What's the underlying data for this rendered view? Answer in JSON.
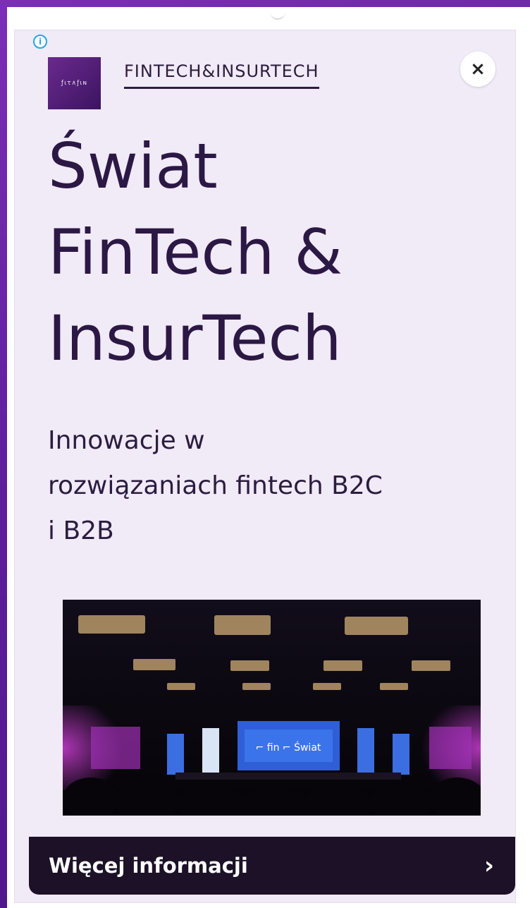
{
  "ad": {
    "advertiser": "FINTECH&INSURTECH",
    "headline_lines": [
      "Świat",
      "FinTech &",
      "InsurTech"
    ],
    "description_lines": [
      "Innowacje w",
      "rozwiązaniach fintech B2C",
      "i B2B"
    ],
    "cta_label": "Więcej informacji",
    "adchoices_glyph": "i",
    "close_glyph": "×",
    "cta_chevron_glyph": "›",
    "image_alt": "Conference hall with stage and audience"
  },
  "colors": {
    "page_background": "#6a23a8",
    "card_background": "#f1eaf7",
    "headline_text": "#2c1844",
    "cta_background": "#1c1126",
    "adchoices_blue": "#27a6e5"
  },
  "icons": {
    "adchoices": "info-icon",
    "close": "close-icon",
    "cta": "chevron-right-icon"
  }
}
